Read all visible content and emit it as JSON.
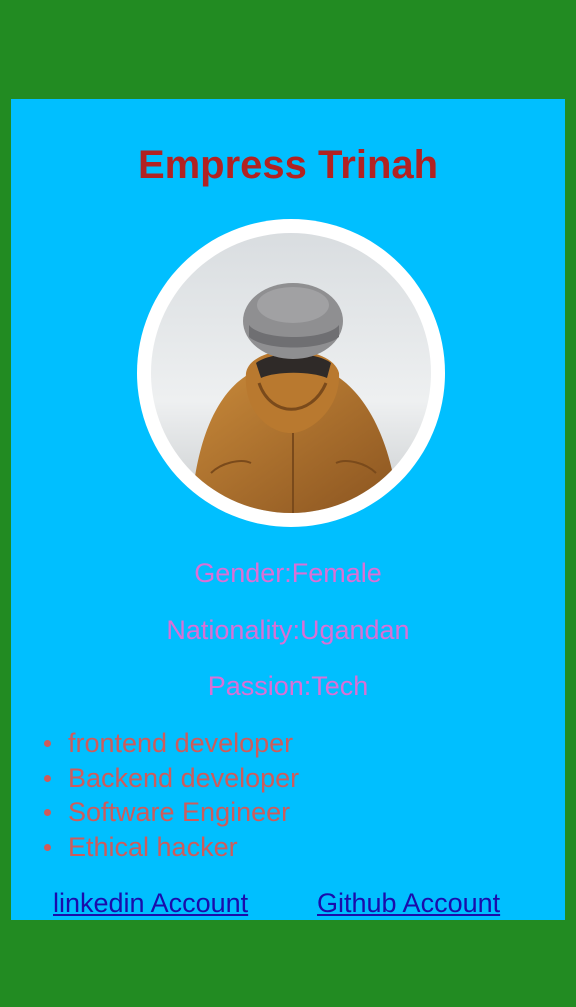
{
  "profile": {
    "name": "Empress Trinah",
    "photo_icon": "person-back-beanie-photo",
    "gender": "Gender:Female",
    "nationality": "Nationality:Ugandan",
    "passion": "Passion:Tech"
  },
  "skills": [
    "frontend developer",
    "Backend developer",
    "Software Engineer",
    "Ethical hacker"
  ],
  "links": {
    "linkedin_label": "linkedin Account",
    "github_label": "Github Account"
  },
  "colors": {
    "page_background": "#228B22",
    "card_background": "#00BFFF",
    "title": "#B22222",
    "info_text": "#DA70D6",
    "skill_text": "#CD5C5C",
    "link": "#1a0dab"
  }
}
